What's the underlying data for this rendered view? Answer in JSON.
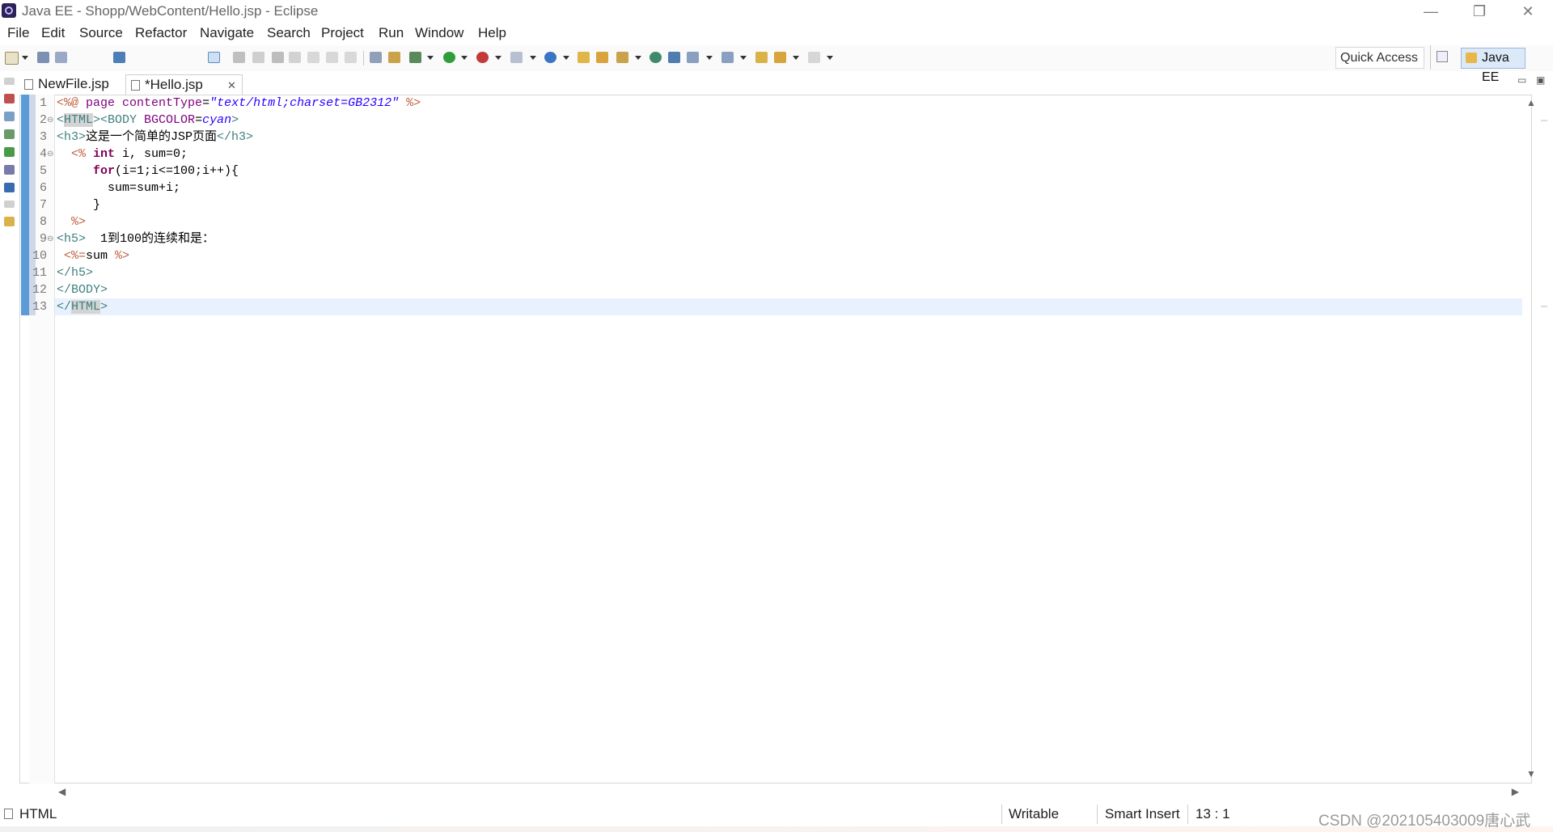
{
  "window": {
    "title": "Java EE - Shopp/WebContent/Hello.jsp - Eclipse",
    "controls": {
      "minimize": "—",
      "restore": "❐",
      "close": "✕"
    }
  },
  "menu": [
    "File",
    "Edit",
    "Source",
    "Refactor",
    "Navigate",
    "Search",
    "Project",
    "Run",
    "Window",
    "Help"
  ],
  "toolbar": {
    "quick_access": "Quick Access",
    "perspective": "Java EE"
  },
  "tabs": [
    {
      "label": "NewFile.jsp",
      "active": false,
      "icon": "jsp-file-icon"
    },
    {
      "label": "*Hello.jsp",
      "active": true,
      "icon": "jsp-file-icon",
      "close": "✕"
    }
  ],
  "editor": {
    "line_numbers": [
      "1",
      "2",
      "3",
      "4",
      "5",
      "6",
      "7",
      "8",
      "9",
      "10",
      "11",
      "12",
      "13"
    ],
    "fold_markers": {
      "2": "⊖",
      "4": "⊖",
      "9": "⊖"
    },
    "lines": [
      [
        {
          "t": "<%@ ",
          "c": "jsp"
        },
        {
          "t": "page ",
          "c": "attr"
        },
        {
          "t": "contentType",
          "c": "attr"
        },
        {
          "t": "=",
          "c": "txt"
        },
        {
          "t": "\"text/html;charset=GB2312\"",
          "c": "val"
        },
        {
          "t": " %>",
          "c": "jsp"
        }
      ],
      [
        {
          "t": "<",
          "c": "tag"
        },
        {
          "t": "HTML",
          "c": "tag",
          "m": true
        },
        {
          "t": "><BODY ",
          "c": "tag"
        },
        {
          "t": "BGCOLOR",
          "c": "attr"
        },
        {
          "t": "=",
          "c": "txt"
        },
        {
          "t": "cyan",
          "c": "val"
        },
        {
          "t": ">",
          "c": "tag"
        }
      ],
      [
        {
          "t": "<h3>",
          "c": "tag"
        },
        {
          "t": "这是一个简单的JSP页面",
          "c": "txt"
        },
        {
          "t": "</h3>",
          "c": "tag"
        }
      ],
      [
        {
          "t": "  <% ",
          "c": "jsp"
        },
        {
          "t": "int",
          "c": "kw"
        },
        {
          "t": " i, sum=0;",
          "c": "txt"
        }
      ],
      [
        {
          "t": "     ",
          "c": "txt"
        },
        {
          "t": "for",
          "c": "kw"
        },
        {
          "t": "(i=1;i<=100;i++){",
          "c": "txt"
        }
      ],
      [
        {
          "t": "       sum=sum+i;",
          "c": "txt"
        }
      ],
      [
        {
          "t": "     }",
          "c": "txt"
        }
      ],
      [
        {
          "t": "  %>",
          "c": "jsp"
        }
      ],
      [
        {
          "t": "<h5>",
          "c": "tag"
        },
        {
          "t": "  1到100的连续和是：",
          "c": "txt"
        }
      ],
      [
        {
          "t": " <%=",
          "c": "jsp"
        },
        {
          "t": "sum ",
          "c": "txt"
        },
        {
          "t": "%>",
          "c": "jsp"
        }
      ],
      [
        {
          "t": "</h5>",
          "c": "tag"
        }
      ],
      [
        {
          "t": "</BODY>",
          "c": "tag"
        }
      ],
      [
        {
          "t": "</",
          "c": "tag"
        },
        {
          "t": "HTML",
          "c": "tag",
          "m": true
        },
        {
          "t": ">",
          "c": "tag"
        }
      ]
    ]
  },
  "status": {
    "language": "HTML",
    "writable": "Writable",
    "insert_mode": "Smart Insert",
    "position": "13 : 1"
  },
  "watermark": "CSDN @202105403009唐心武"
}
